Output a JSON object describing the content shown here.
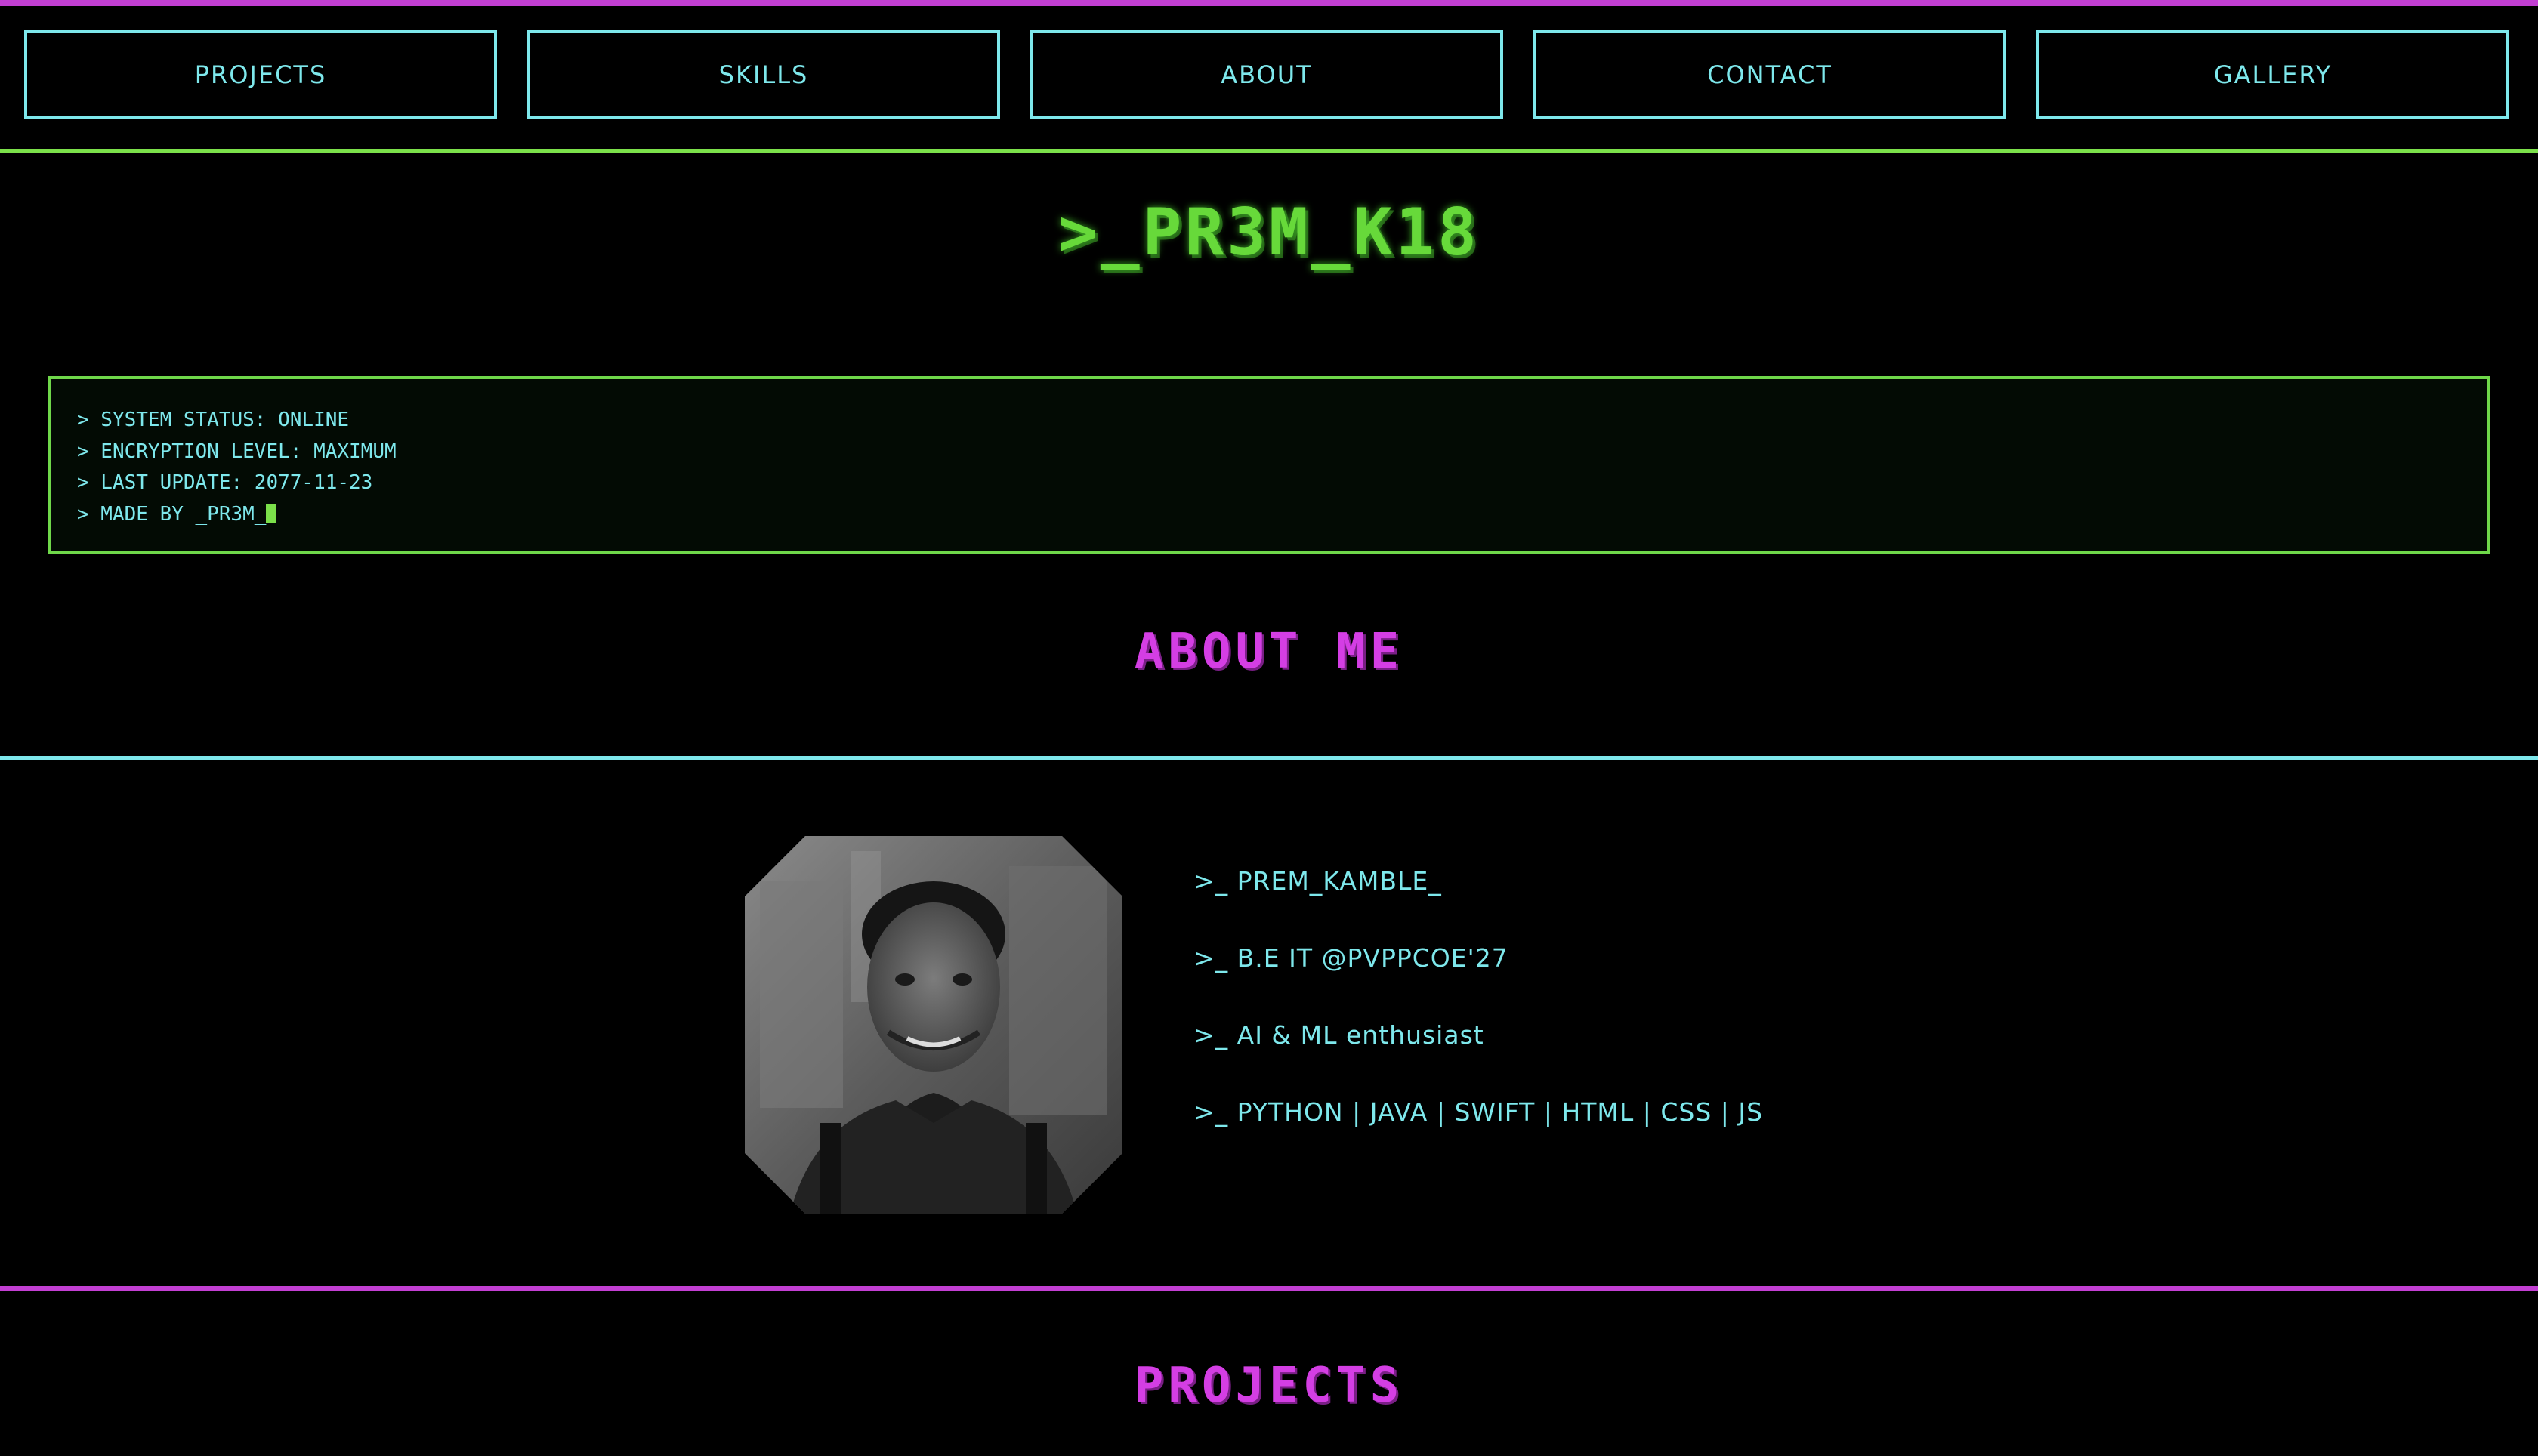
{
  "nav": {
    "items": [
      {
        "label": "PROJECTS"
      },
      {
        "label": "SKILLS"
      },
      {
        "label": "ABOUT"
      },
      {
        "label": "CONTACT"
      },
      {
        "label": "GALLERY"
      }
    ]
  },
  "header": {
    "logo": ">_PR3M_K18"
  },
  "terminal": {
    "lines": [
      "> SYSTEM STATUS: ONLINE",
      "> ENCRYPTION LEVEL: MAXIMUM",
      "> LAST UPDATE: 2077-11-23",
      "> MADE BY _PR3M_"
    ]
  },
  "about": {
    "title": "ABOUT ME",
    "lines": [
      ">_ PREM_KAMBLE_",
      ">_ B.E IT @PVPPCOE'27",
      ">_ AI & ML enthusiast",
      ">_ PYTHON | JAVA | SWIFT | HTML | CSS | JS"
    ]
  },
  "projects": {
    "title": "PROJECTS"
  },
  "colors": {
    "background": "#000000",
    "cyan": "#7ee8ec",
    "green": "#67d93a",
    "magenta": "#d43ee4"
  }
}
